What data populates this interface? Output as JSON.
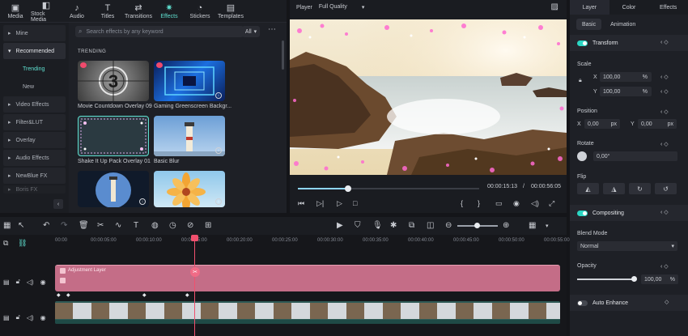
{
  "toolbar": {
    "items": [
      {
        "label": "Media",
        "icon": "media-icon"
      },
      {
        "label": "Stock Media",
        "icon": "stock-media-icon"
      },
      {
        "label": "Audio",
        "icon": "music-note-icon"
      },
      {
        "label": "Titles",
        "icon": "text-icon"
      },
      {
        "label": "Transitions",
        "icon": "transitions-icon"
      },
      {
        "label": "Effects",
        "icon": "sparkle-icon"
      },
      {
        "label": "Stickers",
        "icon": "sticker-icon"
      },
      {
        "label": "Templates",
        "icon": "template-icon"
      }
    ],
    "active_index": 5
  },
  "sidebar": {
    "items": [
      {
        "label": "Mine"
      },
      {
        "label": "Recommended"
      },
      {
        "label": "Trending"
      },
      {
        "label": "New"
      },
      {
        "label": "Video Effects"
      },
      {
        "label": "Filter&LUT"
      },
      {
        "label": "Overlay"
      },
      {
        "label": "Audio Effects"
      },
      {
        "label": "NewBlue FX"
      },
      {
        "label": "Boris FX"
      }
    ]
  },
  "effects": {
    "search_placeholder": "Search effects by any keyword",
    "filter": "All",
    "section": "TRENDING",
    "cards": [
      {
        "label": "Movie Countdown Overlay 09"
      },
      {
        "label": "Gaming Greenscreen Backgr..."
      },
      {
        "label": "Shake It Up Pack Overlay 01"
      },
      {
        "label": "Basic Blur"
      }
    ]
  },
  "player": {
    "label": "Player",
    "quality": "Full Quality",
    "current_time": "00:00:15:13",
    "separator": "/",
    "total_time": "00:00:56:05",
    "progress": 0.28
  },
  "right_panel": {
    "tabs": [
      "Layer",
      "Color",
      "Effects"
    ],
    "subtabs": [
      "Basic",
      "Animation"
    ],
    "transform": "Transform",
    "scale": "Scale",
    "scale_x_label": "X",
    "scale_x": "100,00",
    "scale_y_label": "Y",
    "scale_y": "100,00",
    "percent": "%",
    "position": "Position",
    "pos_x_label": "X",
    "pos_x": "0,00",
    "pos_y_label": "Y",
    "pos_y": "0,00",
    "px": "px",
    "rotate": "Rotate",
    "rotate_value": "0,00°",
    "flip": "Flip",
    "compositing": "Compositing",
    "blend_mode": "Blend Mode",
    "blend_value": "Normal",
    "opacity": "Opacity",
    "opacity_value": "100,00",
    "auto_enhance": "Auto Enhance"
  },
  "timeline": {
    "ticks": [
      "00:00",
      "00:00:05:00",
      "00:00:10:00",
      "00:00:15:00",
      "00:00:20:00",
      "00:00:25:00",
      "00:00:30:00",
      "00:00:35:00",
      "00:00:40:00",
      "00:00:45:00",
      "00:00:50:00",
      "00:00:55:00"
    ],
    "adjustment_layer": "Adjustment Layer"
  }
}
